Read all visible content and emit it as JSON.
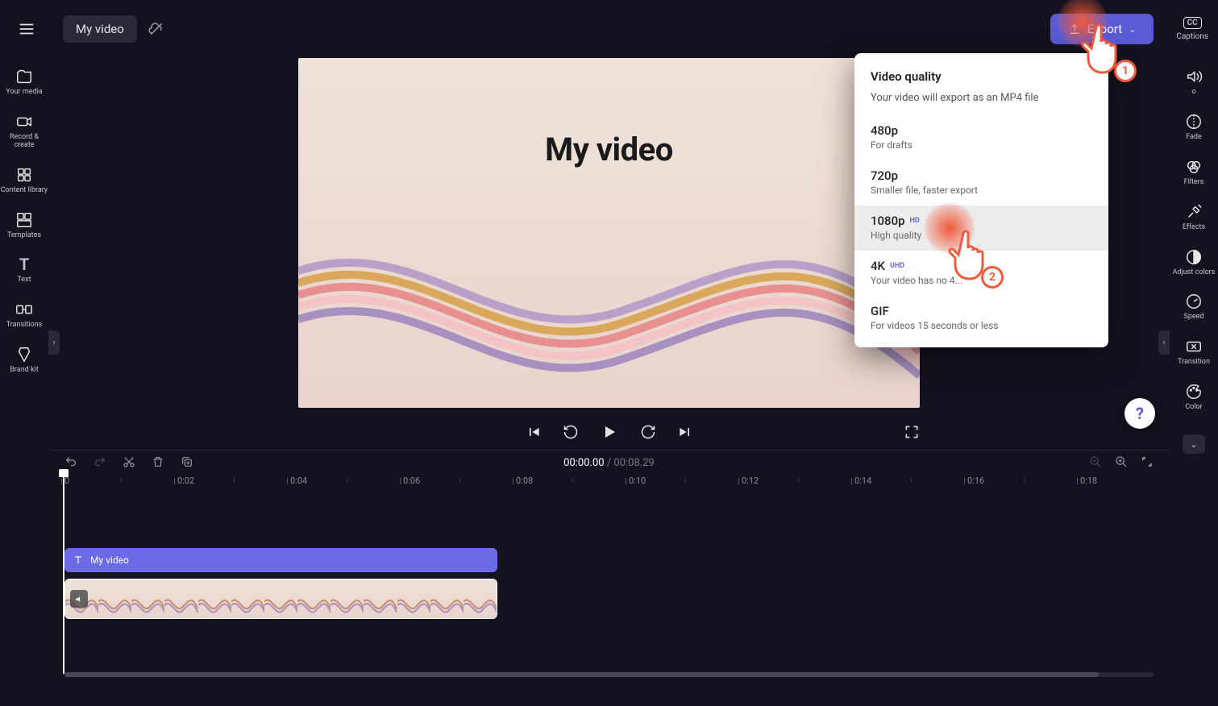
{
  "header": {
    "title": "My video",
    "export_label": "Export",
    "captions_label": "Captions"
  },
  "left_sidebar": {
    "items": [
      {
        "label": "Your media",
        "icon": "folder-icon"
      },
      {
        "label": "Record & create",
        "icon": "camera-icon"
      },
      {
        "label": "Content library",
        "icon": "library-icon"
      },
      {
        "label": "Templates",
        "icon": "templates-icon"
      },
      {
        "label": "Text",
        "icon": "text-icon"
      },
      {
        "label": "Transitions",
        "icon": "transitions-icon"
      },
      {
        "label": "Brand kit",
        "icon": "brandkit-icon"
      }
    ]
  },
  "right_sidebar": {
    "items": [
      {
        "label": "o",
        "icon": "audio-icon"
      },
      {
        "label": "Fade",
        "icon": "fade-icon"
      },
      {
        "label": "Filters",
        "icon": "filters-icon"
      },
      {
        "label": "Effects",
        "icon": "effects-icon"
      },
      {
        "label": "Adjust colors",
        "icon": "adjust-icon"
      },
      {
        "label": "Speed",
        "icon": "speed-icon"
      },
      {
        "label": "Transition",
        "icon": "transition-icon"
      },
      {
        "label": "Color",
        "icon": "color-icon"
      }
    ]
  },
  "preview": {
    "overlay_title": "My video"
  },
  "export_panel": {
    "heading": "Video quality",
    "subtitle": "Your video will export as an MP4 file",
    "options": [
      {
        "title": "480p",
        "desc": "For drafts",
        "badge": ""
      },
      {
        "title": "720p",
        "desc": "Smaller file, faster export",
        "badge": ""
      },
      {
        "title": "1080p",
        "desc": "High quality",
        "badge": "HD",
        "selected": true
      },
      {
        "title": "4K",
        "desc": "Your video has no 4...",
        "badge": "UHD"
      },
      {
        "title": "GIF",
        "desc": "For videos 15 seconds or less",
        "badge": ""
      }
    ]
  },
  "timeline": {
    "current": "00:00.00",
    "total": "00:08.29",
    "ruler_ticks": [
      "0",
      "0:02",
      "0:04",
      "0:06",
      "0:08",
      "0:10",
      "0:12",
      "0:14",
      "0:16",
      "0:18"
    ],
    "text_clip_label": "My video"
  },
  "annotations": {
    "pointer1": "1",
    "pointer2": "2"
  },
  "help_fab": "?"
}
